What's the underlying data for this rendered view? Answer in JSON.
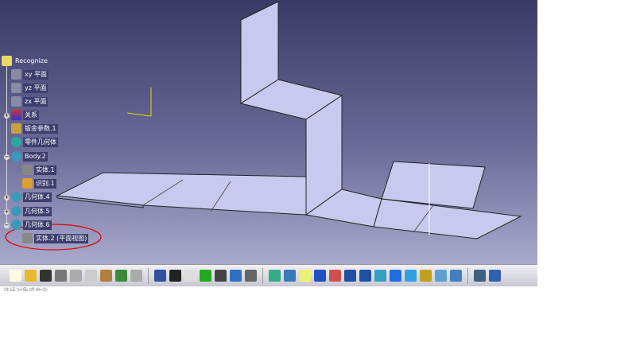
{
  "tree": {
    "root": "Recognize",
    "items": [
      {
        "label": "xy 平面",
        "icon": "plane-icon"
      },
      {
        "label": "yz 平面",
        "icon": "plane-icon"
      },
      {
        "label": "zx 平面",
        "icon": "plane-icon"
      },
      {
        "label": "关系",
        "icon": "relations-icon"
      },
      {
        "label": "钣金参数.1",
        "icon": "sheetmetal-params-icon"
      },
      {
        "label": "零件几何体",
        "icon": "part-body-icon"
      },
      {
        "label": "Body.2",
        "icon": "body-icon"
      },
      {
        "label": "实体.1",
        "icon": "solid-icon"
      },
      {
        "label": "识别.1",
        "icon": "recognize-icon"
      },
      {
        "label": "几何体.4",
        "icon": "body-icon"
      },
      {
        "label": "几何体.5",
        "icon": "body-icon"
      },
      {
        "label": "几何体.6",
        "icon": "body-icon"
      },
      {
        "label": "实体.2 (平面视图)",
        "icon": "solid-icon"
      }
    ]
  },
  "toolbar": {
    "buttons": [
      "new",
      "open",
      "save",
      "print",
      "cut",
      "copy",
      "paste",
      "undo",
      "redo",
      "whats-this",
      "formula",
      "comment",
      "light",
      "table",
      "tree",
      "lock",
      "parameters",
      "fly",
      "fit-all",
      "pan",
      "rotate",
      "zoom-in",
      "zoom-out",
      "normal-view",
      "multi-view",
      "iso-view",
      "shading",
      "hide-show",
      "swap",
      "compass",
      "measure"
    ]
  },
  "status": {
    "text": "选择对象或命令"
  },
  "colors": {
    "part_fill": "#c9c9ef",
    "annotation": "#e00000"
  }
}
